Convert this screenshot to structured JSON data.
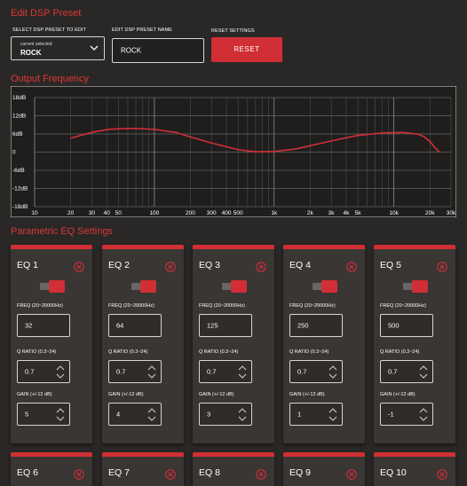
{
  "header": {
    "title": "Edit DSP Preset"
  },
  "preset": {
    "select_label": "SELECT DSP PRESET TO EDIT",
    "current_selected_label": "current selected",
    "selected_value": "ROCK",
    "name_label": "EDIT DSP PRESET NAME",
    "name_value": "ROCK",
    "reset_label": "RESET SETTINGS",
    "reset_button": "RESET"
  },
  "output": {
    "title": "Output Frequency"
  },
  "chart_data": {
    "type": "line",
    "x_scale": "log",
    "xlim": [
      10,
      30000
    ],
    "ylim": [
      -18,
      18
    ],
    "y_ticks": [
      "18dB",
      "12dB",
      "6dB",
      "0",
      "-6dB",
      "-12dB",
      "-18dB"
    ],
    "y_tick_values": [
      18,
      12,
      6,
      0,
      -6,
      -12,
      -18
    ],
    "x_ticks": [
      "10",
      "20",
      "30",
      "40",
      "50",
      "100",
      "200",
      "300",
      "400",
      "500",
      "1k",
      "2k",
      "3k",
      "4k",
      "5k",
      "10k",
      "20k",
      "30k"
    ],
    "x_tick_values": [
      10,
      20,
      30,
      40,
      50,
      100,
      200,
      300,
      400,
      500,
      1000,
      2000,
      3000,
      4000,
      5000,
      10000,
      20000,
      30000
    ],
    "grid": true,
    "line_color": "#d12f35",
    "series": [
      {
        "x": [
          20,
          30,
          40,
          50,
          70,
          100,
          150,
          200,
          300,
          500,
          700,
          1000,
          1500,
          2000,
          3000,
          5000,
          8000,
          12000,
          16000,
          18000,
          20000,
          22000,
          24000
        ],
        "y": [
          4.6,
          6.5,
          7.4,
          7.7,
          7.8,
          7.5,
          6.5,
          5.0,
          3.0,
          0.8,
          0.1,
          0.2,
          1.0,
          2.1,
          3.7,
          5.5,
          6.3,
          6.5,
          5.9,
          5.0,
          3.5,
          1.5,
          0.0
        ]
      }
    ]
  },
  "parametric": {
    "title": "Parametric EQ Settings",
    "freq_label": "FREQ (20~20000Hz)",
    "q_label": "Q RATIO (0.3~24)",
    "gain_label": "GAIN (+/-12 dB)",
    "bands": [
      {
        "name": "EQ 1",
        "freq": "32",
        "q": "0.7",
        "gain": "5"
      },
      {
        "name": "EQ 2",
        "freq": "64",
        "q": "0.7",
        "gain": "4"
      },
      {
        "name": "EQ 3",
        "freq": "125",
        "q": "0.7",
        "gain": "3"
      },
      {
        "name": "EQ 4",
        "freq": "250",
        "q": "0.7",
        "gain": "1"
      },
      {
        "name": "EQ 5",
        "freq": "500",
        "q": "0.7",
        "gain": "-1"
      }
    ],
    "next_bands": [
      "EQ 6",
      "EQ 7",
      "EQ 8",
      "EQ 9",
      "EQ 10"
    ]
  },
  "colors": {
    "background": "#2a2826",
    "card": "#393634",
    "accent": "#d12f35",
    "title_red": "#d9373a"
  },
  "icons": {
    "close": "close-circle-icon",
    "dropdown": "chevron-down-icon",
    "stepper": "stepper-arrows-icon",
    "toggle": "toggle-switch-icon"
  }
}
